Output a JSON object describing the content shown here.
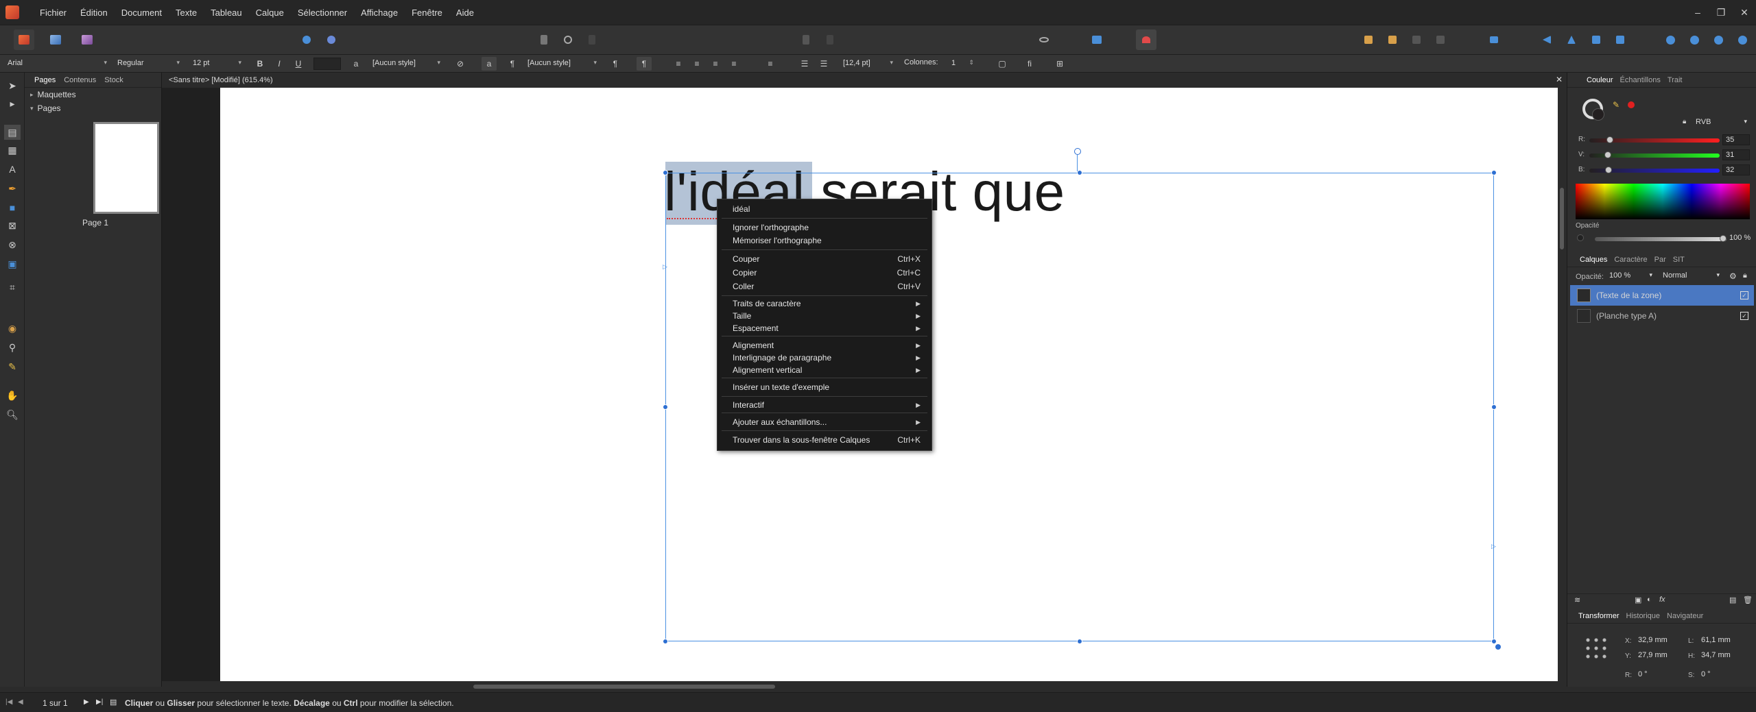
{
  "menubar": {
    "items": [
      "Fichier",
      "Édition",
      "Document",
      "Texte",
      "Tableau",
      "Calque",
      "Sélectionner",
      "Affichage",
      "Fenêtre",
      "Aide"
    ]
  },
  "context_toolbar": {
    "font": "Arial",
    "style": "Regular",
    "size": "12 pt",
    "bold": "B",
    "italic": "I",
    "underline": "U",
    "char_style": "[Aucun style]",
    "para_style": "[Aucun style]",
    "leading": "[12,4 pt]",
    "columns_label": "Colonnes:",
    "columns_value": "1"
  },
  "pages_panel": {
    "tabs": [
      "Pages",
      "Contenus",
      "Stock"
    ],
    "masters_label": "Maquettes",
    "pages_label": "Pages",
    "page_name": "Page 1"
  },
  "document": {
    "tab_title": "<Sans titre> [Modifié] (615.4%)",
    "selected_text": "l'idéal",
    "rest_text": " serait que"
  },
  "context_menu": {
    "items": [
      {
        "label": "idéal",
        "shortcut": "",
        "submenu": false
      },
      {
        "label": "Ignorer l'orthographe",
        "shortcut": "",
        "submenu": false
      },
      {
        "label": "Mémoriser l'orthographe",
        "shortcut": "",
        "submenu": false
      },
      {
        "label": "Couper",
        "shortcut": "Ctrl+X",
        "submenu": false
      },
      {
        "label": "Copier",
        "shortcut": "Ctrl+C",
        "submenu": false
      },
      {
        "label": "Coller",
        "shortcut": "Ctrl+V",
        "submenu": false
      },
      {
        "label": "Traits de caractère",
        "shortcut": "",
        "submenu": true
      },
      {
        "label": "Taille",
        "shortcut": "",
        "submenu": true
      },
      {
        "label": "Espacement",
        "shortcut": "",
        "submenu": true
      },
      {
        "label": "Alignement",
        "shortcut": "",
        "submenu": true
      },
      {
        "label": "Interlignage de paragraphe",
        "shortcut": "",
        "submenu": true
      },
      {
        "label": "Alignement vertical",
        "shortcut": "",
        "submenu": true
      },
      {
        "label": "Insérer un texte d'exemple",
        "shortcut": "",
        "submenu": false
      },
      {
        "label": "Interactif",
        "shortcut": "",
        "submenu": true
      },
      {
        "label": "Ajouter aux échantillons...",
        "shortcut": "",
        "submenu": true
      },
      {
        "label": "Trouver dans la sous-fenêtre Calques",
        "shortcut": "Ctrl+K",
        "submenu": false
      }
    ]
  },
  "color_panel": {
    "tabs": [
      "Couleur",
      "Échantillons",
      "Trait"
    ],
    "model": "RVB",
    "r_label": "R:",
    "g_label": "V:",
    "b_label": "B:",
    "r": "35",
    "g": "31",
    "b": "32",
    "r_level": 0.137,
    "g_level": 0.122,
    "b_level": 0.125,
    "opacity_label": "Opacité",
    "opacity": "100 %",
    "opacity_level": 1.0
  },
  "layers_panel": {
    "tabs": [
      "Calques",
      "Caractère",
      "Par",
      "SIT"
    ],
    "opacity_label": "Opacité:",
    "opacity": "100 %",
    "blend": "Normal",
    "layers": [
      "(Texte de la zone)",
      "(Planche type A)"
    ]
  },
  "transform_panel": {
    "tabs": [
      "Transformer",
      "Historique",
      "Navigateur"
    ],
    "x_label": "X:",
    "x": "32,9 mm",
    "y_label": "Y:",
    "y": "27,9 mm",
    "w_label": "L:",
    "w": "61,1 mm",
    "h_label": "H:",
    "h": "34,7 mm",
    "r_label": "R:",
    "r": "0 °",
    "s_label": "S:",
    "s": "0 °"
  },
  "status": {
    "page_count": "1 sur 1",
    "hint_click": "Cliquer",
    "hint_or1": " ou ",
    "hint_drag": "Glisser",
    "hint_mid": " pour sélectionner le texte. ",
    "hint_shift": "Décalage",
    "hint_or2": " ou ",
    "hint_ctrl": "Ctrl",
    "hint_end": " pour modifier la sélection."
  },
  "colors": {
    "accent": "#4a90e2",
    "selection": "#b4c3d6",
    "layer_highlight": "#4a78c2"
  }
}
